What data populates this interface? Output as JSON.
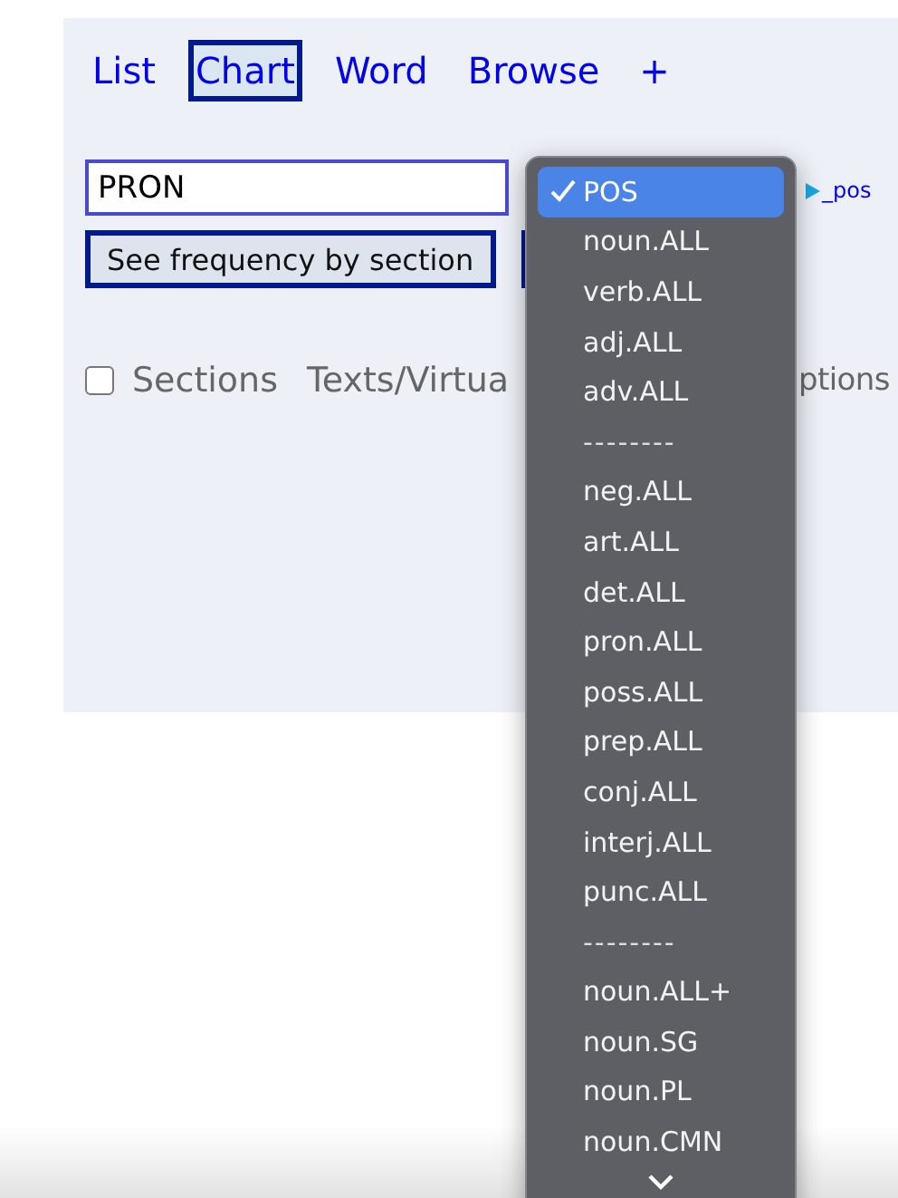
{
  "tabs": [
    {
      "label": "List",
      "selected": false
    },
    {
      "label": "Chart",
      "selected": true
    },
    {
      "label": "Word",
      "selected": false
    },
    {
      "label": "Browse",
      "selected": false
    },
    {
      "label": "+",
      "selected": false
    }
  ],
  "query": {
    "value": "PRON"
  },
  "pos_link": "_pos",
  "buttons": [
    "See frequency by section"
  ],
  "options_row": {
    "sections": {
      "label": "Sections",
      "checked": false
    },
    "texts": "Texts/Virtua",
    "options": "ptions"
  },
  "dropdown": {
    "items": [
      {
        "label": "POS",
        "selected": true,
        "kind": "option"
      },
      {
        "label": "noun.ALL",
        "selected": false,
        "kind": "option"
      },
      {
        "label": "verb.ALL",
        "selected": false,
        "kind": "option"
      },
      {
        "label": "adj.ALL",
        "selected": false,
        "kind": "option"
      },
      {
        "label": "adv.ALL",
        "selected": false,
        "kind": "option"
      },
      {
        "label": "--------",
        "kind": "separator"
      },
      {
        "label": "neg.ALL",
        "selected": false,
        "kind": "option"
      },
      {
        "label": "art.ALL",
        "selected": false,
        "kind": "option"
      },
      {
        "label": "det.ALL",
        "selected": false,
        "kind": "option"
      },
      {
        "label": "pron.ALL",
        "selected": false,
        "kind": "option"
      },
      {
        "label": "poss.ALL",
        "selected": false,
        "kind": "option"
      },
      {
        "label": "prep.ALL",
        "selected": false,
        "kind": "option"
      },
      {
        "label": "conj.ALL",
        "selected": false,
        "kind": "option"
      },
      {
        "label": "interj.ALL",
        "selected": false,
        "kind": "option"
      },
      {
        "label": "punc.ALL",
        "selected": false,
        "kind": "option"
      },
      {
        "label": "--------",
        "kind": "separator"
      },
      {
        "label": "noun.ALL+",
        "selected": false,
        "kind": "option"
      },
      {
        "label": "noun.SG",
        "selected": false,
        "kind": "option"
      },
      {
        "label": "noun.PL",
        "selected": false,
        "kind": "option"
      },
      {
        "label": "noun.CMN",
        "selected": false,
        "kind": "option"
      }
    ]
  }
}
